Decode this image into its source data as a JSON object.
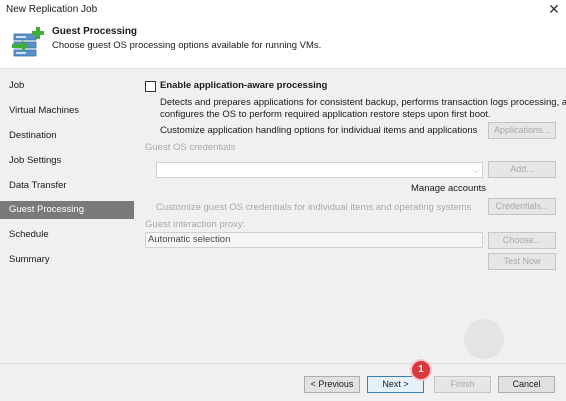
{
  "window": {
    "title": "New Replication Job",
    "close_icon": "close-icon"
  },
  "header": {
    "title": "Guest Processing",
    "subtitle": "Choose guest OS processing options available for running VMs.",
    "icon": "server-add-icon"
  },
  "sidebar": {
    "items": [
      {
        "label": "Job"
      },
      {
        "label": "Virtual Machines"
      },
      {
        "label": "Destination"
      },
      {
        "label": "Job Settings"
      },
      {
        "label": "Data Transfer"
      },
      {
        "label": "Guest Processing",
        "active": true
      },
      {
        "label": "Schedule"
      },
      {
        "label": "Summary"
      }
    ]
  },
  "content": {
    "app_aware": {
      "label": "Enable application-aware processing",
      "checked": false,
      "desc_line1": "Detects and prepares applications for consistent backup, performs transaction logs processing, and",
      "desc_line2": "configures the OS to perform required application restore steps upon first boot.",
      "customize_text": "Customize application handling options for individual items and applications",
      "applications_button": "Applications..."
    },
    "credentials": {
      "label": "Guest OS credentials",
      "value": "",
      "add_button": "Add...",
      "manage_accounts": "Manage accounts",
      "customize_text": "Customize guest OS credentials for individual items and operating systems",
      "credentials_button": "Credentials..."
    },
    "proxy": {
      "label": "Guest interaction proxy:",
      "value": "Automatic selection",
      "choose_button": "Choose...",
      "test_button": "Test Now"
    }
  },
  "footer": {
    "previous": "< Previous",
    "next": "Next >",
    "finish": "Finish",
    "cancel": "Cancel",
    "badge": "1"
  },
  "colors": {
    "active_nav": "#7a7a7a",
    "disabled_text": "#a8a8a8",
    "primary_border": "#3c7fb1",
    "badge": "#d9363e",
    "icon_green": "#3dae3a"
  }
}
